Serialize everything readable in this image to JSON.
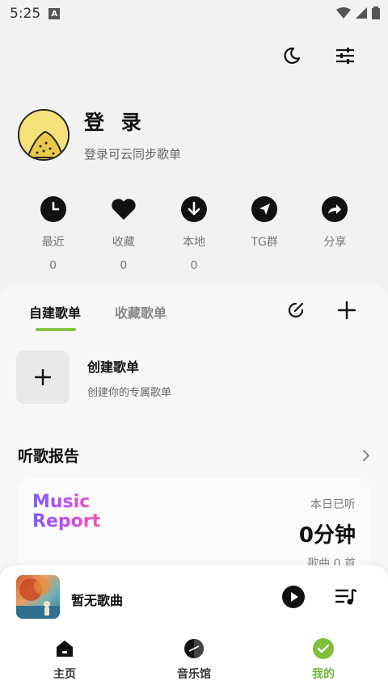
{
  "status_bar": {
    "time": "5:25",
    "badge": "A"
  },
  "profile": {
    "title": "登 录",
    "subtitle": "登录可云同步歌单"
  },
  "quick_actions": [
    {
      "label": "最近",
      "count": "0",
      "icon": "clock-icon"
    },
    {
      "label": "收藏",
      "count": "0",
      "icon": "heart-icon"
    },
    {
      "label": "本地",
      "count": "0",
      "icon": "download-icon"
    },
    {
      "label": "TG群",
      "count": "",
      "icon": "telegram-icon"
    },
    {
      "label": "分享",
      "count": "",
      "icon": "share-icon"
    }
  ],
  "tabs": [
    {
      "label": "自建歌单",
      "active": true
    },
    {
      "label": "收藏歌单",
      "active": false
    }
  ],
  "create_playlist": {
    "title": "创建歌单",
    "subtitle": "创建你的专属歌单"
  },
  "report": {
    "title": "听歌报告",
    "logo_line1": "Music",
    "logo_line2": "Report",
    "today_label": "本日已听",
    "today_value": "0分钟",
    "songs_count": "歌曲 0 首"
  },
  "player": {
    "title": "暂无歌曲"
  },
  "bottom_nav": [
    {
      "label": "主页",
      "icon": "home-icon"
    },
    {
      "label": "音乐馆",
      "icon": "music-hall-icon"
    },
    {
      "label": "我的",
      "icon": "mine-icon",
      "active": true
    }
  ],
  "colors": {
    "accent": "#7fbf3b",
    "tab_underline": "#8bc34a"
  }
}
